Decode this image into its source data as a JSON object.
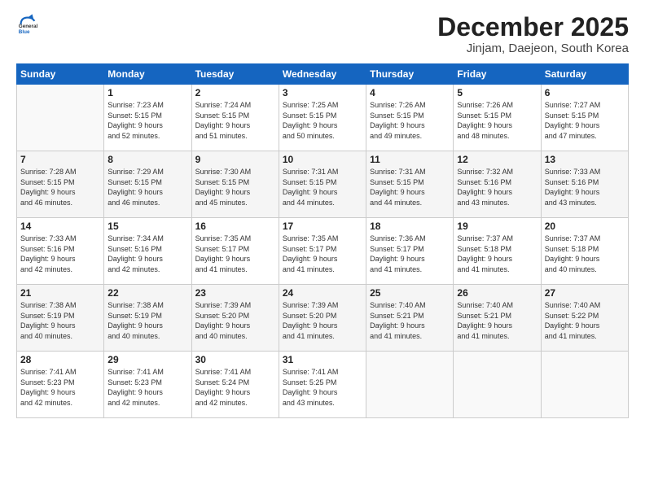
{
  "logo": {
    "general": "General",
    "blue": "Blue"
  },
  "title": "December 2025",
  "subtitle": "Jinjam, Daejeon, South Korea",
  "weekdays": [
    "Sunday",
    "Monday",
    "Tuesday",
    "Wednesday",
    "Thursday",
    "Friday",
    "Saturday"
  ],
  "weeks": [
    [
      {
        "day": "",
        "info": ""
      },
      {
        "day": "1",
        "info": "Sunrise: 7:23 AM\nSunset: 5:15 PM\nDaylight: 9 hours\nand 52 minutes."
      },
      {
        "day": "2",
        "info": "Sunrise: 7:24 AM\nSunset: 5:15 PM\nDaylight: 9 hours\nand 51 minutes."
      },
      {
        "day": "3",
        "info": "Sunrise: 7:25 AM\nSunset: 5:15 PM\nDaylight: 9 hours\nand 50 minutes."
      },
      {
        "day": "4",
        "info": "Sunrise: 7:26 AM\nSunset: 5:15 PM\nDaylight: 9 hours\nand 49 minutes."
      },
      {
        "day": "5",
        "info": "Sunrise: 7:26 AM\nSunset: 5:15 PM\nDaylight: 9 hours\nand 48 minutes."
      },
      {
        "day": "6",
        "info": "Sunrise: 7:27 AM\nSunset: 5:15 PM\nDaylight: 9 hours\nand 47 minutes."
      }
    ],
    [
      {
        "day": "7",
        "info": "Sunrise: 7:28 AM\nSunset: 5:15 PM\nDaylight: 9 hours\nand 46 minutes."
      },
      {
        "day": "8",
        "info": "Sunrise: 7:29 AM\nSunset: 5:15 PM\nDaylight: 9 hours\nand 46 minutes."
      },
      {
        "day": "9",
        "info": "Sunrise: 7:30 AM\nSunset: 5:15 PM\nDaylight: 9 hours\nand 45 minutes."
      },
      {
        "day": "10",
        "info": "Sunrise: 7:31 AM\nSunset: 5:15 PM\nDaylight: 9 hours\nand 44 minutes."
      },
      {
        "day": "11",
        "info": "Sunrise: 7:31 AM\nSunset: 5:15 PM\nDaylight: 9 hours\nand 44 minutes."
      },
      {
        "day": "12",
        "info": "Sunrise: 7:32 AM\nSunset: 5:16 PM\nDaylight: 9 hours\nand 43 minutes."
      },
      {
        "day": "13",
        "info": "Sunrise: 7:33 AM\nSunset: 5:16 PM\nDaylight: 9 hours\nand 43 minutes."
      }
    ],
    [
      {
        "day": "14",
        "info": "Sunrise: 7:33 AM\nSunset: 5:16 PM\nDaylight: 9 hours\nand 42 minutes."
      },
      {
        "day": "15",
        "info": "Sunrise: 7:34 AM\nSunset: 5:16 PM\nDaylight: 9 hours\nand 42 minutes."
      },
      {
        "day": "16",
        "info": "Sunrise: 7:35 AM\nSunset: 5:17 PM\nDaylight: 9 hours\nand 41 minutes."
      },
      {
        "day": "17",
        "info": "Sunrise: 7:35 AM\nSunset: 5:17 PM\nDaylight: 9 hours\nand 41 minutes."
      },
      {
        "day": "18",
        "info": "Sunrise: 7:36 AM\nSunset: 5:17 PM\nDaylight: 9 hours\nand 41 minutes."
      },
      {
        "day": "19",
        "info": "Sunrise: 7:37 AM\nSunset: 5:18 PM\nDaylight: 9 hours\nand 41 minutes."
      },
      {
        "day": "20",
        "info": "Sunrise: 7:37 AM\nSunset: 5:18 PM\nDaylight: 9 hours\nand 40 minutes."
      }
    ],
    [
      {
        "day": "21",
        "info": "Sunrise: 7:38 AM\nSunset: 5:19 PM\nDaylight: 9 hours\nand 40 minutes."
      },
      {
        "day": "22",
        "info": "Sunrise: 7:38 AM\nSunset: 5:19 PM\nDaylight: 9 hours\nand 40 minutes."
      },
      {
        "day": "23",
        "info": "Sunrise: 7:39 AM\nSunset: 5:20 PM\nDaylight: 9 hours\nand 40 minutes."
      },
      {
        "day": "24",
        "info": "Sunrise: 7:39 AM\nSunset: 5:20 PM\nDaylight: 9 hours\nand 41 minutes."
      },
      {
        "day": "25",
        "info": "Sunrise: 7:40 AM\nSunset: 5:21 PM\nDaylight: 9 hours\nand 41 minutes."
      },
      {
        "day": "26",
        "info": "Sunrise: 7:40 AM\nSunset: 5:21 PM\nDaylight: 9 hours\nand 41 minutes."
      },
      {
        "day": "27",
        "info": "Sunrise: 7:40 AM\nSunset: 5:22 PM\nDaylight: 9 hours\nand 41 minutes."
      }
    ],
    [
      {
        "day": "28",
        "info": "Sunrise: 7:41 AM\nSunset: 5:23 PM\nDaylight: 9 hours\nand 42 minutes."
      },
      {
        "day": "29",
        "info": "Sunrise: 7:41 AM\nSunset: 5:23 PM\nDaylight: 9 hours\nand 42 minutes."
      },
      {
        "day": "30",
        "info": "Sunrise: 7:41 AM\nSunset: 5:24 PM\nDaylight: 9 hours\nand 42 minutes."
      },
      {
        "day": "31",
        "info": "Sunrise: 7:41 AM\nSunset: 5:25 PM\nDaylight: 9 hours\nand 43 minutes."
      },
      {
        "day": "",
        "info": ""
      },
      {
        "day": "",
        "info": ""
      },
      {
        "day": "",
        "info": ""
      }
    ]
  ]
}
